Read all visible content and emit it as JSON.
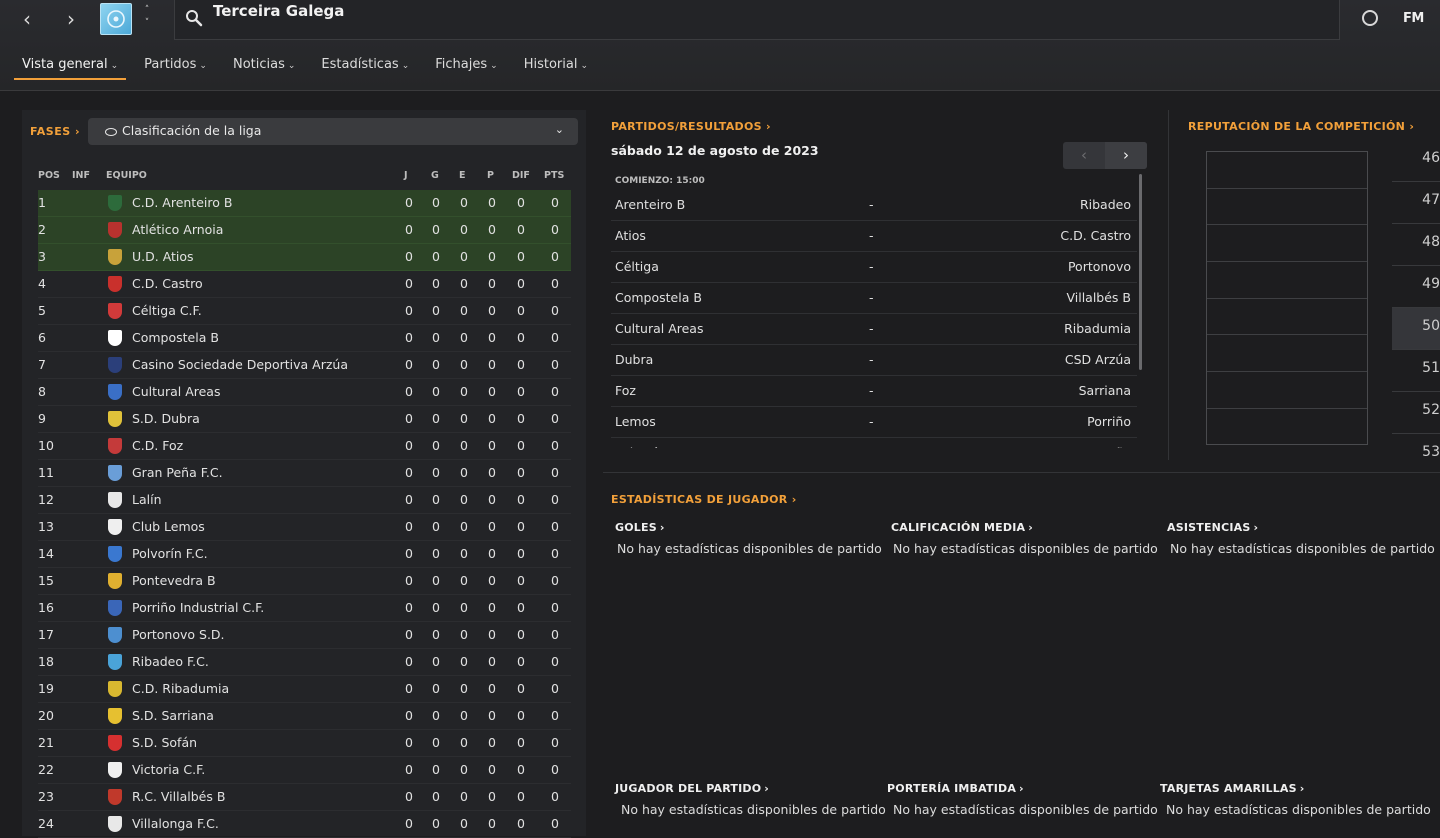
{
  "header": {
    "title": "Terceira Galega",
    "fm_logo": "FM",
    "back_glyph": "‹",
    "forward_glyph": "›",
    "updown_glyph_up": "˄",
    "updown_glyph_down": "˅",
    "icons": {
      "search": "search-icon",
      "globe": "globe-icon",
      "competition": "competition-logo"
    }
  },
  "tabs": [
    {
      "label": "Vista general",
      "active": true
    },
    {
      "label": "Partidos"
    },
    {
      "label": "Noticias"
    },
    {
      "label": "Estadísticas"
    },
    {
      "label": "Fichajes"
    },
    {
      "label": "Historial"
    }
  ],
  "fases": {
    "label": "FASES",
    "arrow": "›",
    "selected": "Clasificación de la liga"
  },
  "table": {
    "headers": {
      "pos": "POS",
      "inf": "INF",
      "team": "EQUIPO",
      "j": "J",
      "g": "G",
      "e": "E",
      "p": "P",
      "dif": "DIF",
      "pts": "PTS"
    },
    "rows": [
      {
        "pos": "1",
        "team": "C.D. Arenteiro B",
        "j": "0",
        "g": "0",
        "e": "0",
        "p": "0",
        "dif": "0",
        "pts": "0",
        "promo": true,
        "badge_color": "#2d6b3b"
      },
      {
        "pos": "2",
        "team": "Atlético Arnoia",
        "j": "0",
        "g": "0",
        "e": "0",
        "p": "0",
        "dif": "0",
        "pts": "0",
        "promo": true,
        "badge_color": "#b8322e"
      },
      {
        "pos": "3",
        "team": "U.D. Atios",
        "j": "0",
        "g": "0",
        "e": "0",
        "p": "0",
        "dif": "0",
        "pts": "0",
        "promo": true,
        "badge_color": "#c8a23a"
      },
      {
        "pos": "4",
        "team": "C.D. Castro",
        "j": "0",
        "g": "0",
        "e": "0",
        "p": "0",
        "dif": "0",
        "pts": "0",
        "badge_color": "#c9302c"
      },
      {
        "pos": "5",
        "team": "Céltiga C.F.",
        "j": "0",
        "g": "0",
        "e": "0",
        "p": "0",
        "dif": "0",
        "pts": "0",
        "badge_color": "#d23a3a"
      },
      {
        "pos": "6",
        "team": "Compostela B",
        "j": "0",
        "g": "0",
        "e": "0",
        "p": "0",
        "dif": "0",
        "pts": "0",
        "badge_color": "#ffffff"
      },
      {
        "pos": "7",
        "team": "Casino Sociedade Deportiva Arzúa",
        "j": "0",
        "g": "0",
        "e": "0",
        "p": "0",
        "dif": "0",
        "pts": "0",
        "badge_color": "#2b3f7a"
      },
      {
        "pos": "8",
        "team": "Cultural Areas",
        "j": "0",
        "g": "0",
        "e": "0",
        "p": "0",
        "dif": "0",
        "pts": "0",
        "badge_color": "#3a6fc6"
      },
      {
        "pos": "9",
        "team": "S.D. Dubra",
        "j": "0",
        "g": "0",
        "e": "0",
        "p": "0",
        "dif": "0",
        "pts": "0",
        "badge_color": "#e0c23a"
      },
      {
        "pos": "10",
        "team": "C.D. Foz",
        "j": "0",
        "g": "0",
        "e": "0",
        "p": "0",
        "dif": "0",
        "pts": "0",
        "badge_color": "#c43a3a"
      },
      {
        "pos": "11",
        "team": "Gran Peña F.C.",
        "j": "0",
        "g": "0",
        "e": "0",
        "p": "0",
        "dif": "0",
        "pts": "0",
        "badge_color": "#6a9ed8"
      },
      {
        "pos": "12",
        "team": "Lalín",
        "j": "0",
        "g": "0",
        "e": "0",
        "p": "0",
        "dif": "0",
        "pts": "0",
        "badge_color": "#e8e8e8"
      },
      {
        "pos": "13",
        "team": "Club Lemos",
        "j": "0",
        "g": "0",
        "e": "0",
        "p": "0",
        "dif": "0",
        "pts": "0",
        "badge_color": "#efefef"
      },
      {
        "pos": "14",
        "team": "Polvorín F.C.",
        "j": "0",
        "g": "0",
        "e": "0",
        "p": "0",
        "dif": "0",
        "pts": "0",
        "badge_color": "#3a78d0"
      },
      {
        "pos": "15",
        "team": "Pontevedra B",
        "j": "0",
        "g": "0",
        "e": "0",
        "p": "0",
        "dif": "0",
        "pts": "0",
        "badge_color": "#e0b030"
      },
      {
        "pos": "16",
        "team": "Porriño Industrial C.F.",
        "j": "0",
        "g": "0",
        "e": "0",
        "p": "0",
        "dif": "0",
        "pts": "0",
        "badge_color": "#3a66b8"
      },
      {
        "pos": "17",
        "team": "Portonovo S.D.",
        "j": "0",
        "g": "0",
        "e": "0",
        "p": "0",
        "dif": "0",
        "pts": "0",
        "badge_color": "#4d8fd0"
      },
      {
        "pos": "18",
        "team": "Ribadeo F.C.",
        "j": "0",
        "g": "0",
        "e": "0",
        "p": "0",
        "dif": "0",
        "pts": "0",
        "badge_color": "#4aa3d8"
      },
      {
        "pos": "19",
        "team": "C.D. Ribadumia",
        "j": "0",
        "g": "0",
        "e": "0",
        "p": "0",
        "dif": "0",
        "pts": "0",
        "badge_color": "#d8b830"
      },
      {
        "pos": "20",
        "team": "S.D. Sarriana",
        "j": "0",
        "g": "0",
        "e": "0",
        "p": "0",
        "dif": "0",
        "pts": "0",
        "badge_color": "#e6c030"
      },
      {
        "pos": "21",
        "team": "S.D. Sofán",
        "j": "0",
        "g": "0",
        "e": "0",
        "p": "0",
        "dif": "0",
        "pts": "0",
        "badge_color": "#d63030"
      },
      {
        "pos": "22",
        "team": "Victoria C.F.",
        "j": "0",
        "g": "0",
        "e": "0",
        "p": "0",
        "dif": "0",
        "pts": "0",
        "badge_color": "#f0f0f0"
      },
      {
        "pos": "23",
        "team": "R.C. Villalbés B",
        "j": "0",
        "g": "0",
        "e": "0",
        "p": "0",
        "dif": "0",
        "pts": "0",
        "badge_color": "#c0392b"
      },
      {
        "pos": "24",
        "team": "Villalonga F.C.",
        "j": "0",
        "g": "0",
        "e": "0",
        "p": "0",
        "dif": "0",
        "pts": "0",
        "badge_color": "#e8e8e8"
      }
    ]
  },
  "matches": {
    "title": "PARTIDOS/RESULTADOS",
    "arrow": "›",
    "date": "sábado 12 de agosto de 2023",
    "prev_glyph": "‹",
    "next_glyph": "›",
    "kickoff": "COMIENZO: 15:00",
    "fixtures": [
      {
        "home": "Arenteiro B",
        "sep": "-",
        "away": "Ribadeo"
      },
      {
        "home": "Atios",
        "sep": "-",
        "away": "C.D. Castro"
      },
      {
        "home": "Céltiga",
        "sep": "-",
        "away": "Portonovo"
      },
      {
        "home": "Compostela B",
        "sep": "-",
        "away": "Villalbés B"
      },
      {
        "home": "Cultural Areas",
        "sep": "-",
        "away": "Ribadumia"
      },
      {
        "home": "Dubra",
        "sep": "-",
        "away": "CSD Arzúa"
      },
      {
        "home": "Foz",
        "sep": "-",
        "away": "Sarriana"
      },
      {
        "home": "Lemos",
        "sep": "-",
        "away": "Porriño"
      },
      {
        "home": "Polvorín",
        "sep": "-",
        "away": "Gran Peña"
      }
    ]
  },
  "reputation": {
    "title": "REPUTACIÓN DE LA COMPETICIÓN",
    "arrow": "›",
    "ranks": [
      "46",
      "47",
      "48",
      "49",
      "50",
      "51",
      "52",
      "53"
    ],
    "selected_rank": "50"
  },
  "player_stats": {
    "title": "ESTADÍSTICAS DE JUGADOR",
    "arrow": "›",
    "empty_text": "No hay estadísticas disponibles de partido",
    "cards": [
      {
        "title": "GOLES"
      },
      {
        "title": "CALIFICACIÓN MEDIA"
      },
      {
        "title": "ASISTENCIAS"
      },
      {
        "title": "JUGADOR DEL PARTIDO"
      },
      {
        "title": "PORTERÍA IMBATIDA"
      },
      {
        "title": "TARJETAS AMARILLAS"
      }
    ]
  },
  "colors": {
    "accent": "#f2a03a",
    "promotion_row": "#2c4326",
    "background": "#1d1d1f",
    "panel": "#232427"
  }
}
